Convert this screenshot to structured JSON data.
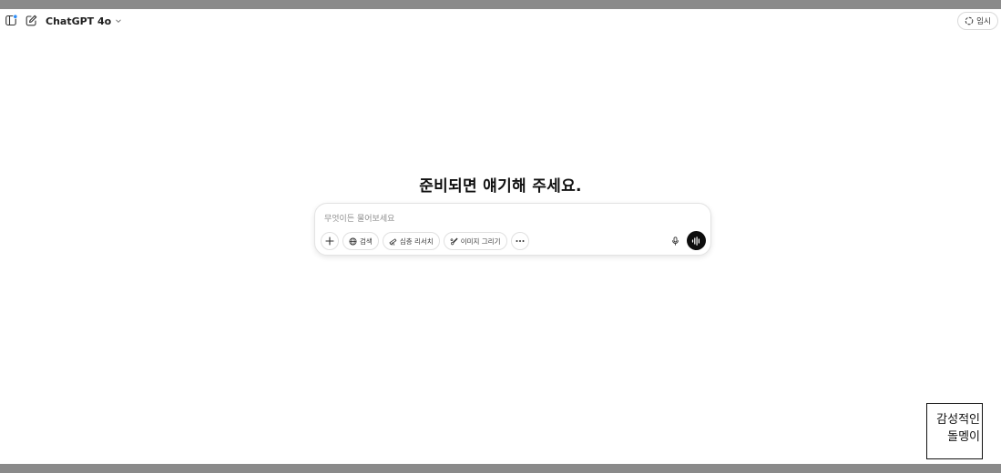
{
  "header": {
    "model_name": "ChatGPT 4o",
    "temporary_label": "임시",
    "accent_dot_color": "#2b8cf7"
  },
  "main": {
    "headline": "준비되면 얘기해 주세요.",
    "composer": {
      "placeholder": "무엇이든 물어보세요",
      "value": "",
      "tools": [
        {
          "icon": "globe-icon",
          "label": "검색"
        },
        {
          "icon": "telescope-icon",
          "label": "심층 리서치"
        },
        {
          "icon": "paint-brush-icon",
          "label": "이미지 그리기"
        }
      ]
    }
  },
  "stamp": {
    "line1": "감성적인",
    "line2": "돌멩이"
  }
}
